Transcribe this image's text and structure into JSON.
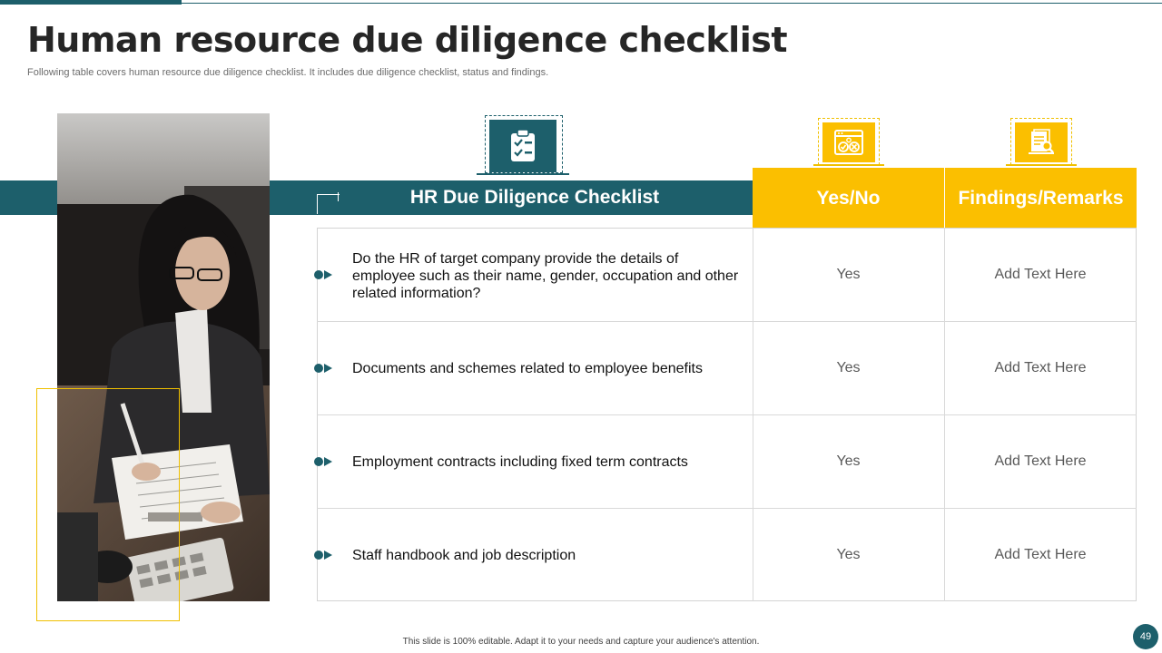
{
  "slide": {
    "title": "Human resource due diligence checklist",
    "subtitle": "Following table covers human resource due diligence checklist. It includes due diligence checklist, status and findings.",
    "footer": "This slide is 100% editable. Adapt it to your needs and capture your audience's attention.",
    "page_number": "49"
  },
  "colors": {
    "teal": "#1d5f6b",
    "gold": "#fbbf00",
    "gold_frame": "#f0c000"
  },
  "icons": {
    "checklist": "clipboard-checklist-icon",
    "status": "browser-window-icon",
    "findings": "document-search-icon"
  },
  "table": {
    "headers": {
      "checklist": "HR Due Diligence  Checklist",
      "status": "Yes/No",
      "findings": "Findings/Remarks"
    },
    "rows": [
      {
        "item": "Do the HR of target company provide the details of employee such as their name, gender, occupation and other related information?",
        "status": "Yes",
        "findings": "Add Text Here"
      },
      {
        "item": "Documents and schemes related to employee benefits",
        "status": "Yes",
        "findings": "Add Text Here"
      },
      {
        "item": "Employment contracts including fixed term contracts",
        "status": "Yes",
        "findings": "Add Text Here"
      },
      {
        "item": "Staff handbook and job description",
        "status": "Yes",
        "findings": "Add Text Here"
      }
    ]
  }
}
